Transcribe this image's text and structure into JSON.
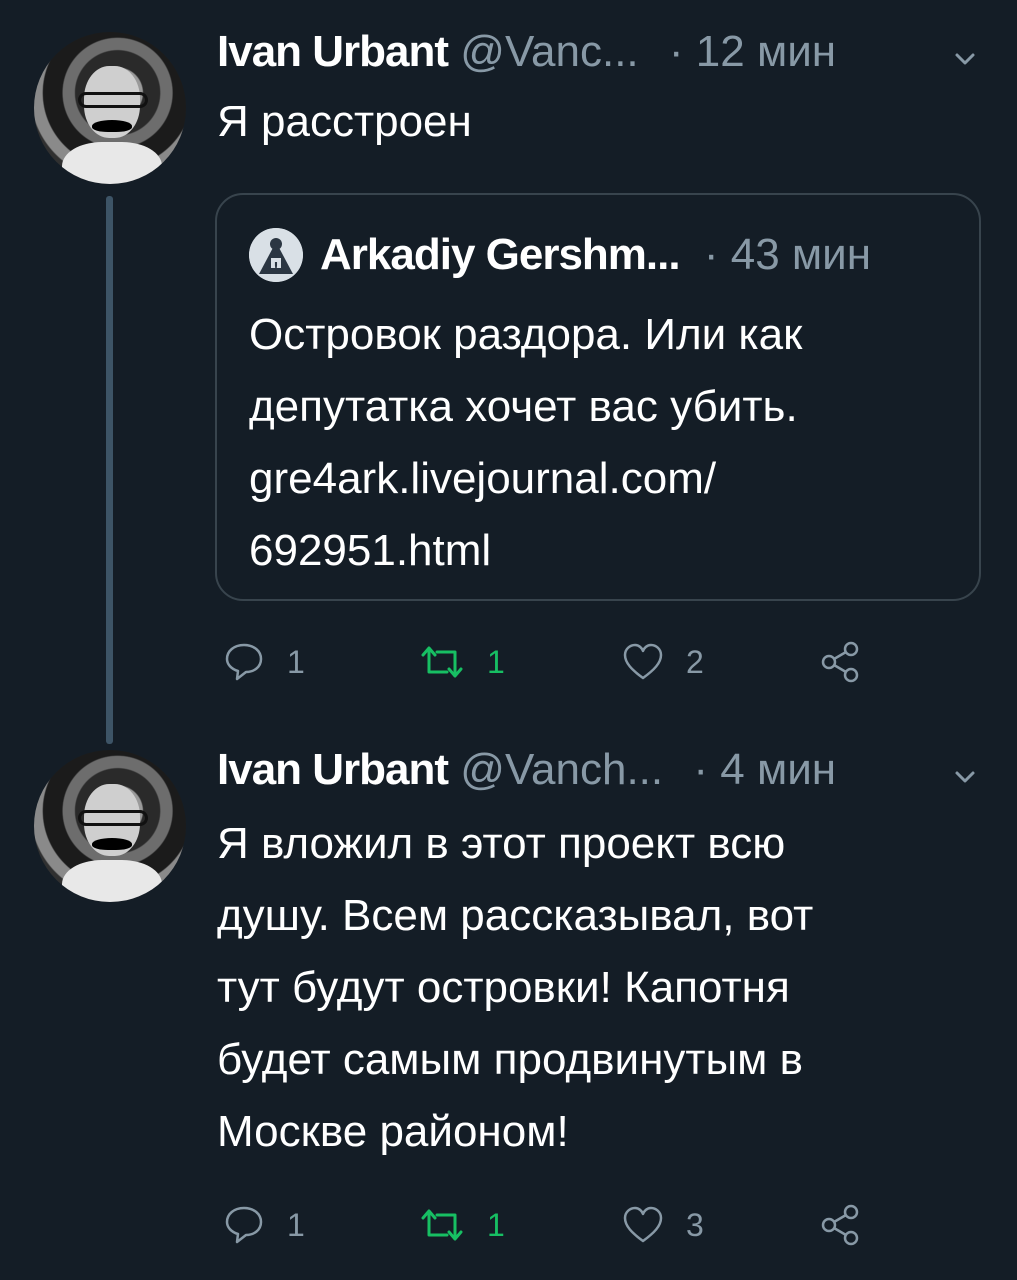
{
  "colors": {
    "background": "#141d26",
    "muted": "#8899a6",
    "retweet_active": "#17bf63",
    "border": "#38444d"
  },
  "tweets": [
    {
      "name": "Ivan Urbant",
      "handle": "@Vanc...",
      "dot": "·",
      "time": "12 мин",
      "text": "Я расстроен",
      "quote": {
        "name": "Arkadiy Gershm...",
        "dot": "·",
        "time": "43 мин",
        "text_lines": [
          "Островок раздора. Или как",
          "депутатка хочет вас убить.",
          "gre4ark.livejournal.com/",
          "692951.html"
        ]
      },
      "actions": {
        "replies": "1",
        "retweets": "1",
        "likes": "2"
      }
    },
    {
      "name": "Ivan Urbant",
      "handle": "@Vanch...",
      "dot": "·",
      "time": "4 мин",
      "text_lines": [
        "Я вложил в этот проект всю",
        "душу. Всем рассказывал, вот",
        "тут будут островки! Капотня",
        "будет самым продвинутым в",
        "Москве районом!"
      ],
      "actions": {
        "replies": "1",
        "retweets": "1",
        "likes": "3"
      }
    }
  ],
  "icons": [
    "reply-icon",
    "retweet-icon",
    "like-icon",
    "share-icon",
    "chevron-down-icon"
  ]
}
